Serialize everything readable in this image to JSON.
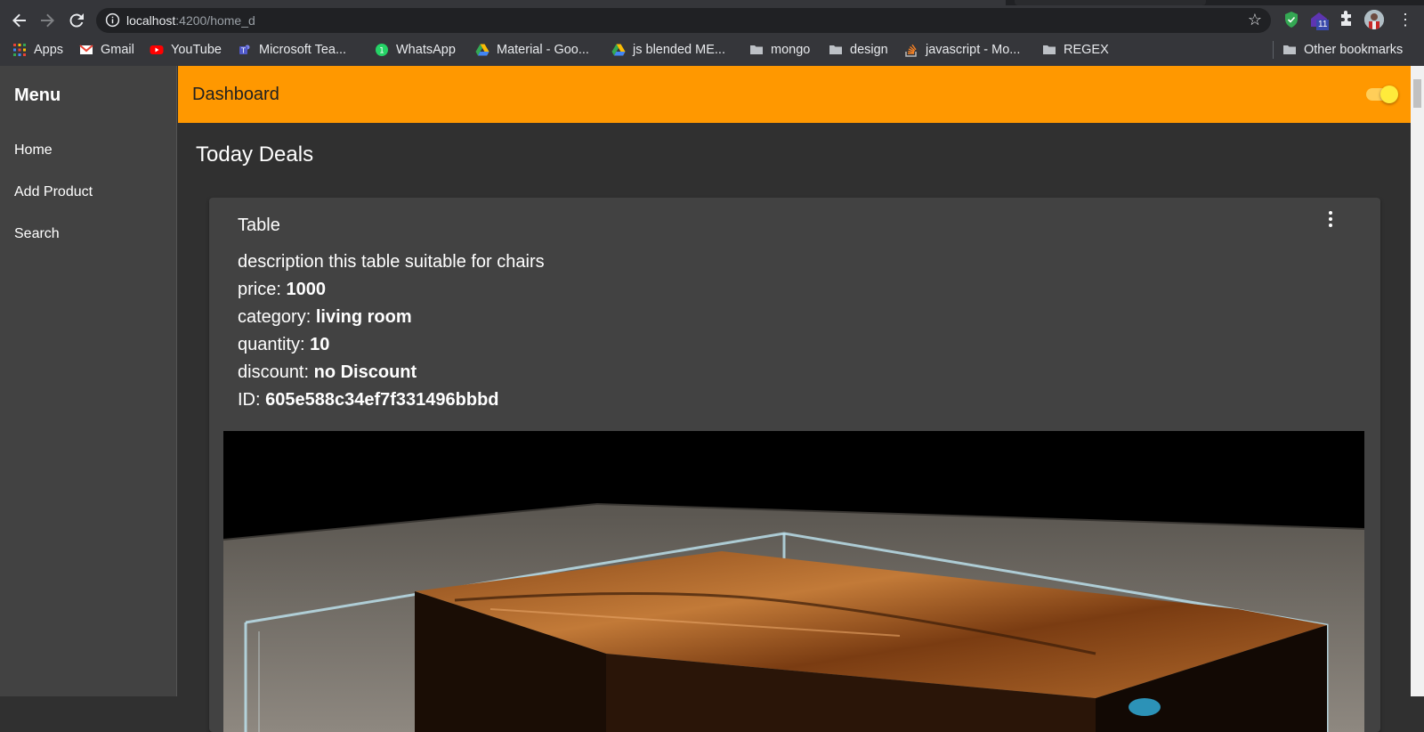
{
  "browser": {
    "url_host": "localhost",
    "url_path": ":4200/home_d",
    "extension_badge": "11",
    "bookmarks": [
      {
        "label": "Apps",
        "icon": "apps-grid-icon"
      },
      {
        "label": "Gmail",
        "icon": "gmail-icon"
      },
      {
        "label": "YouTube",
        "icon": "youtube-icon"
      },
      {
        "label": "Microsoft Tea...",
        "icon": "teams-icon"
      },
      {
        "label": "WhatsApp",
        "icon": "whatsapp-icon"
      },
      {
        "label": "Material - Goo...",
        "icon": "drive-icon"
      },
      {
        "label": "js blended ME...",
        "icon": "drive-icon"
      },
      {
        "label": "mongo",
        "icon": "folder-icon"
      },
      {
        "label": "design",
        "icon": "folder-icon"
      },
      {
        "label": "javascript - Mo...",
        "icon": "stackoverflow-icon"
      },
      {
        "label": "REGEX",
        "icon": "folder-icon"
      }
    ],
    "other_bookmarks": "Other bookmarks"
  },
  "sidebar": {
    "title": "Menu",
    "items": [
      {
        "label": "Home"
      },
      {
        "label": "Add Product"
      },
      {
        "label": "Search"
      }
    ]
  },
  "toolbar": {
    "title": "Dashboard",
    "theme_toggle_on": true,
    "accent": "#ff9800"
  },
  "main": {
    "section_title": "Today Deals",
    "product": {
      "title": "Table",
      "description": "description this table suitable for chairs",
      "price_label": "price: ",
      "price": "1000",
      "category_label": "category: ",
      "category": "living room",
      "quantity_label": "quantity: ",
      "quantity": "10",
      "discount_label": "discount: ",
      "discount": "no Discount",
      "id_label": "ID: ",
      "id": "605e588c34ef7f331496bbbd"
    }
  }
}
